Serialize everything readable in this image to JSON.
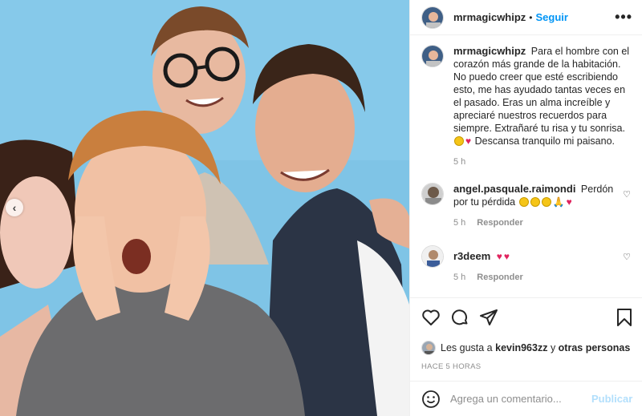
{
  "post": {
    "username": "mrmagicwhipz",
    "follow_label": "Seguir",
    "separator": "•",
    "more_label": "•••",
    "carousel_prev": "‹"
  },
  "caption": {
    "username": "mrmagicwhipz",
    "text": "Para el hombre con el corazón más grande de la habitación. No puedo creer que esté escribiendo esto, me has ayudado tantas veces en el pasado. Eras un alma increíble y apreciaré nuestros recuerdos para siempre. Extrañaré tu risa y tu sonrisa.",
    "text_tail": "Descansa tranquilo mi paisano.",
    "time": "5 h"
  },
  "comments": [
    {
      "username": "angel.pasquale.raimondi",
      "text": "Perdón por tu pérdida",
      "time": "5 h",
      "reply_label": "Responder"
    },
    {
      "username": "r3deem",
      "text": "",
      "time": "5 h",
      "reply_label": "Responder"
    }
  ],
  "likes": {
    "prefix": "Les gusta a",
    "user": "kevin963zz",
    "joiner": "y",
    "others": "otras personas"
  },
  "time_ago": "HACE 5 HORAS",
  "composer": {
    "placeholder": "Agrega un comentario...",
    "publish_label": "Publicar"
  },
  "colors": {
    "accent": "#0095f6",
    "publish_disabled": "#b2dffc",
    "photo_background": "#7fc4e6",
    "heart": "#e0245e"
  },
  "icons": [
    "heart-icon",
    "comment-icon",
    "share-icon",
    "bookmark-icon",
    "smiley-icon",
    "more-icon",
    "chevron-left-icon"
  ]
}
